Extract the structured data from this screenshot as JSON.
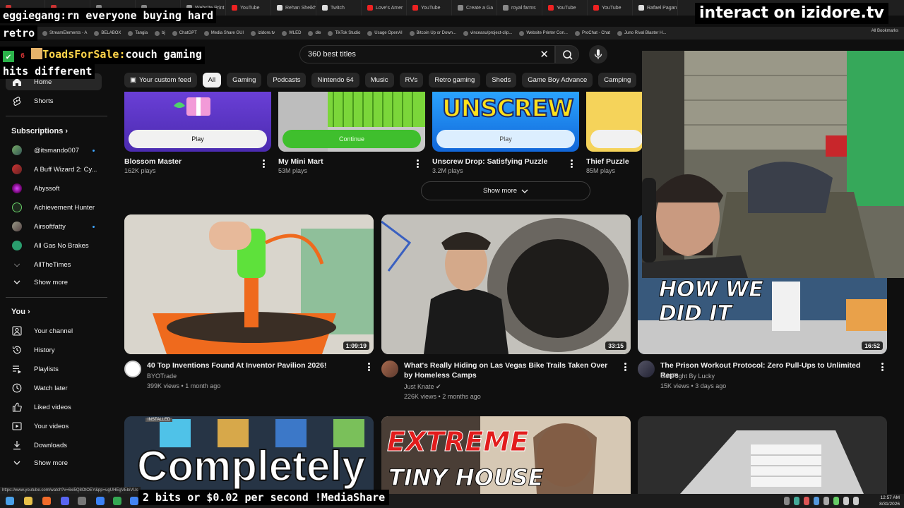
{
  "browser": {
    "tabs": [
      "",
      "",
      "",
      "",
      "Website Print",
      "YouTube",
      "Rehan Sheikh",
      "Twitch",
      "Love's Amer",
      "YouTube",
      "Create a Ga",
      "royal farms",
      "YouTube",
      "YouTube",
      "Rafael Pagan"
    ],
    "bookmarks": [
      "StreamElements - A",
      "BELABOX",
      "Tangia",
      "bj",
      "ChatGPT",
      "Media Share GUI",
      "izidore.tv",
      "WLED",
      "dle",
      "TikTok Studio",
      "Usage OpenAI",
      "Bitcoin Up or Down...",
      "vinceasu/project-clip...",
      "Website Printer Con...",
      "ProChat - Chat",
      "Juno Rival Blaster H..."
    ],
    "all_bookmarks": "All Bookmarks",
    "status_url": "https://www.youtube.com/watch?v=6xi5Q8OtOEY&pp=ugUHEgVEbiVUs"
  },
  "search": {
    "query": "360 best titles"
  },
  "chips": [
    "Your custom feed",
    "All",
    "Gaming",
    "Podcasts",
    "Nintendo 64",
    "Music",
    "RVs",
    "Retro gaming",
    "Sheds",
    "Game Boy Advance",
    "Camping"
  ],
  "sidebar": {
    "home": "Home",
    "shorts": "Shorts",
    "subscriptions_title": "Subscriptions",
    "subscriptions": [
      "@itsmando007",
      "A Buff Wizard 2: Cy...",
      "Abyssoft",
      "Achievement Hunter",
      "Airsoftfatty",
      "All Gas No Brakes",
      "AllTheTimes"
    ],
    "show_more_1": "Show more",
    "you_title": "You",
    "you_items": [
      "Your channel",
      "History",
      "Playlists",
      "Watch later",
      "Liked videos",
      "Your videos",
      "Downloads"
    ],
    "show_more_2": "Show more"
  },
  "games": [
    {
      "title": "Blossom Master",
      "plays": "162K plays",
      "button": "Play"
    },
    {
      "title": "My Mini Mart",
      "plays": "53M plays",
      "button": "Continue"
    },
    {
      "title": "Unscrew Drop: Satisfying Puzzle",
      "plays": "3.2M plays",
      "button": "Play",
      "art_text": "UNSCREW"
    },
    {
      "title": "Thief Puzzle",
      "plays": "85M plays",
      "button": ""
    }
  ],
  "show_more": "Show more",
  "videos": [
    {
      "title": "40 Top Inventions Found At Inventor Pavilion 2026!",
      "channel": "BYOTrade",
      "views": "399K views",
      "age": "1 month ago",
      "duration": "1:09:19"
    },
    {
      "title": "What's Really Hiding on Las Vegas Bike Trails Taken Over by Homeless Camps",
      "channel": "Just Knate",
      "views": "226K views",
      "age": "2 months ago",
      "duration": "33:15"
    },
    {
      "title": "The Prison Workout Protocol: Zero Pull-Ups to Unlimited Reps",
      "channel": "Get Right By Lucky",
      "views": "15K views",
      "age": "3 days ago",
      "duration": "16:52",
      "thumb_text": "HOW WE DID IT"
    },
    {
      "thumb_text": "Completely",
      "badge": "INSTALLED"
    },
    {
      "thumb_text_1": "EXTREME",
      "thumb_text_2": "TINY HOUSE"
    },
    {}
  ],
  "overlay": {
    "chat1_user": "eggiegang:",
    "chat1_msg": "rn everyone buying hard",
    "chat1_cont": "retro",
    "chat2_badge": "6",
    "chat2_user": "ToadsForSale:",
    "chat2_msg": "couch gaming",
    "chat2_cont": "hits different",
    "interact": "interact on izidore.tv",
    "mediashare": "2 bits or $0.02 per second !MediaShare"
  },
  "taskbar": {
    "time": "12:57 AM",
    "date": "8/31/2026"
  },
  "colors": {
    "background": "#0f0f0f",
    "chip": "#272727",
    "accent": "#3ea6ff"
  }
}
